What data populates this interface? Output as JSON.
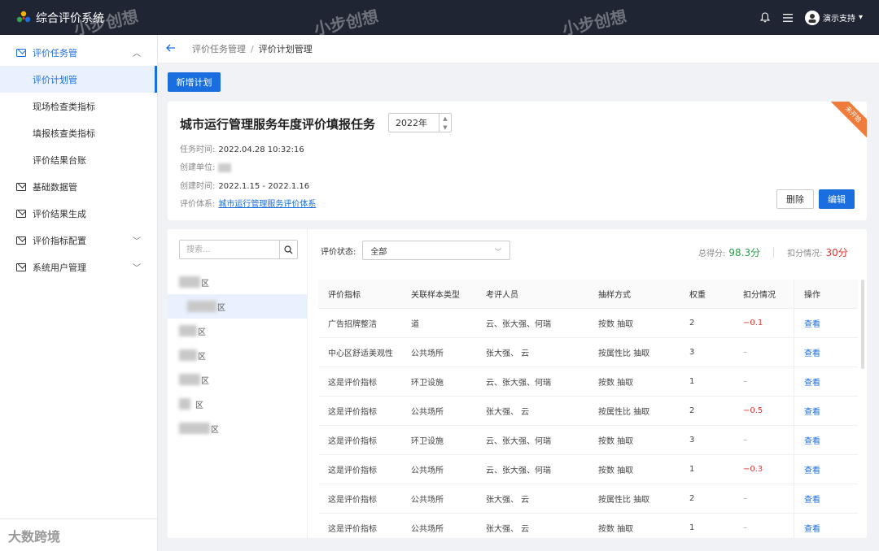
{
  "app": {
    "title": "综合评价系统",
    "user_name": "演示支持"
  },
  "sidebar": {
    "items": [
      {
        "label": "评价任务管",
        "expanded": true
      },
      {
        "label": "评价计划管",
        "active": true
      },
      {
        "label": "现场检查类指标"
      },
      {
        "label": "填报核查类指标"
      },
      {
        "label": "评价结果台账"
      },
      {
        "label": "基础数据管"
      },
      {
        "label": "评价结果生成"
      },
      {
        "label": "评价指标配置"
      },
      {
        "label": "系统用户管理"
      }
    ]
  },
  "breadcrumb": {
    "parent": "评价任务管理",
    "separator": "/",
    "current": "评价计划管理"
  },
  "toolbar": {
    "new_plan_label": "新增计划"
  },
  "task": {
    "title": "城市运行管理服务年度评价填报任务",
    "year": "2022年",
    "status_ribbon": "未开始",
    "task_time_label": "任务时间:",
    "task_time": "2022.04.28 10:32:16",
    "creator_unit_label": "创建单位:",
    "created_time_label": "创建时间:",
    "created_time": "2022.1.15 - 2022.1.16",
    "system_label": "评价体系:",
    "system_value": "城市运行管理服务评价体系",
    "delete_label": "删除",
    "edit_label": "编辑"
  },
  "districts": {
    "search_placeholder": "搜索...",
    "items": [
      {
        "suffix": "区"
      },
      {
        "suffix": "区"
      },
      {
        "suffix": "区"
      },
      {
        "suffix": "区"
      },
      {
        "suffix": "区"
      },
      {
        "suffix": "区"
      },
      {
        "suffix": "区"
      }
    ]
  },
  "filter": {
    "status_label": "评价状态:",
    "status_value": "全部"
  },
  "score": {
    "total_label": "总得分:",
    "total_value": "98.3分",
    "deduct_label": "扣分情况:",
    "deduct_value": "30分"
  },
  "table": {
    "headers": [
      "评价指标",
      "关联样本类型",
      "考评人员",
      "抽样方式",
      "权重",
      "扣分情况",
      "操作"
    ],
    "rows": [
      {
        "indicator": "广告招牌整洁",
        "type": "道",
        "staff": "云、张大强、何瑞",
        "method": "按数  抽取",
        "weight": "2",
        "deduct": "−0.1",
        "action": "查看"
      },
      {
        "indicator": "中心区舒适美观性",
        "type": "公共场所",
        "staff": "张大强、 云",
        "method": "按属性比  抽取",
        "weight": "3",
        "deduct": "–",
        "action": "查看"
      },
      {
        "indicator": "这是评价指标",
        "type": "环卫设施",
        "staff": "云、张大强、何瑞",
        "method": "按数  抽取",
        "weight": "1",
        "deduct": "–",
        "action": "查看"
      },
      {
        "indicator": "这是评价指标",
        "type": "公共场所",
        "staff": "张大强、 云",
        "method": "按属性比  抽取",
        "weight": "2",
        "deduct": "−0.5",
        "action": "查看"
      },
      {
        "indicator": "这是评价指标",
        "type": "环卫设施",
        "staff": "云、张大强、何瑞",
        "method": "按数  抽取",
        "weight": "3",
        "deduct": "–",
        "action": "查看"
      },
      {
        "indicator": "这是评价指标",
        "type": "公共场所",
        "staff": "云、张大强、何瑞",
        "method": "按数  抽取",
        "weight": "1",
        "deduct": "−0.3",
        "action": "查看"
      },
      {
        "indicator": "这是评价指标",
        "type": "公共场所",
        "staff": "张大强、 云",
        "method": "按属性比  抽取",
        "weight": "2",
        "deduct": "–",
        "action": "查看"
      },
      {
        "indicator": "这是评价指标",
        "type": "公共场所",
        "staff": "张大强、 云",
        "method": "按数  抽取",
        "weight": "1",
        "deduct": "–",
        "action": "查看"
      }
    ]
  },
  "watermarks": {
    "brand": "小步创想",
    "footer": "大数跨境"
  },
  "colors": {
    "primary": "#1a6ee0",
    "topbar": "#1f2532",
    "positive": "#27a046",
    "negative": "#e5322d",
    "ribbon": "#f07c3c"
  },
  "icons": [
    "logo-icon",
    "bell-icon",
    "menu-icon",
    "avatar-icon",
    "mail-icon",
    "chevron-up-icon",
    "chevron-down-icon",
    "back-arrow-icon",
    "search-icon"
  ]
}
